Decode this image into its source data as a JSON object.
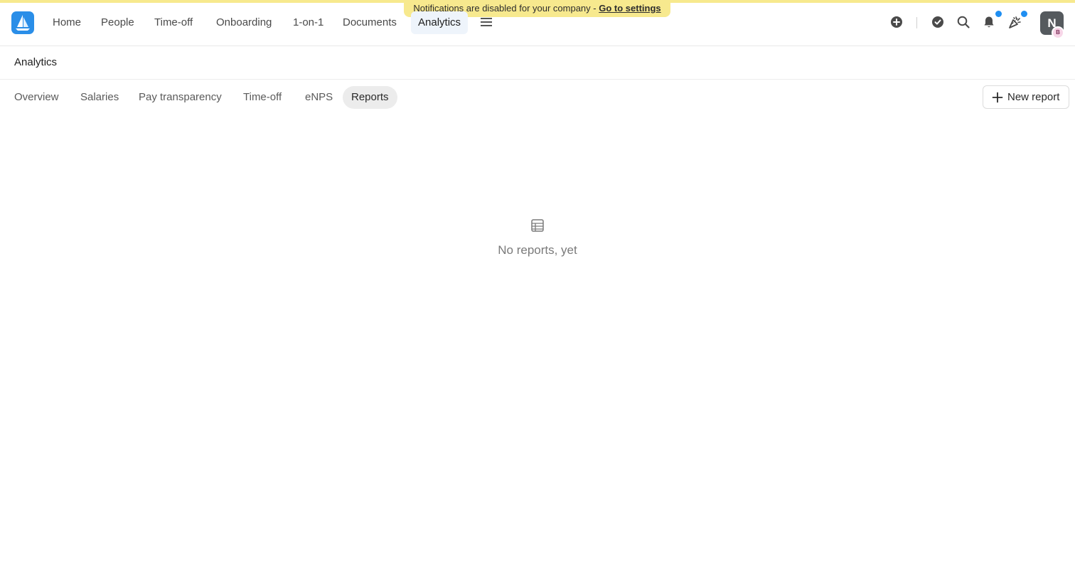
{
  "banner": {
    "text": "Notifications are disabled for your company - ",
    "link": "Go to settings"
  },
  "nav": {
    "items": [
      {
        "label": "Home"
      },
      {
        "label": "People"
      },
      {
        "label": "Time-off"
      },
      {
        "label": "Onboarding"
      },
      {
        "label": "1-on-1"
      },
      {
        "label": "Documents"
      },
      {
        "label": "Analytics",
        "active": true
      }
    ],
    "menu_icon": "hamburger-icon"
  },
  "toolbar": {
    "icons": [
      "add-circle-icon",
      "check-circle-icon",
      "search-icon",
      "bell-icon",
      "celebration-icon"
    ],
    "badge_color": "#1f8ef1"
  },
  "user": {
    "avatar_initial": "N",
    "badge_initial": "B"
  },
  "page": {
    "title": "Analytics"
  },
  "tabs": [
    {
      "label": "Overview"
    },
    {
      "label": "Salaries"
    },
    {
      "label": "Pay transparency"
    },
    {
      "label": "Time-off"
    },
    {
      "label": "eNPS"
    },
    {
      "label": "Reports",
      "active": true
    }
  ],
  "actions": {
    "new_report": "New report"
  },
  "empty_state": {
    "icon": "table-icon",
    "text": "No reports, yet"
  },
  "colors": {
    "banner": "#f7e98e",
    "brand": "#2a8ee8",
    "active_nav_bg": "#eef4fb"
  }
}
